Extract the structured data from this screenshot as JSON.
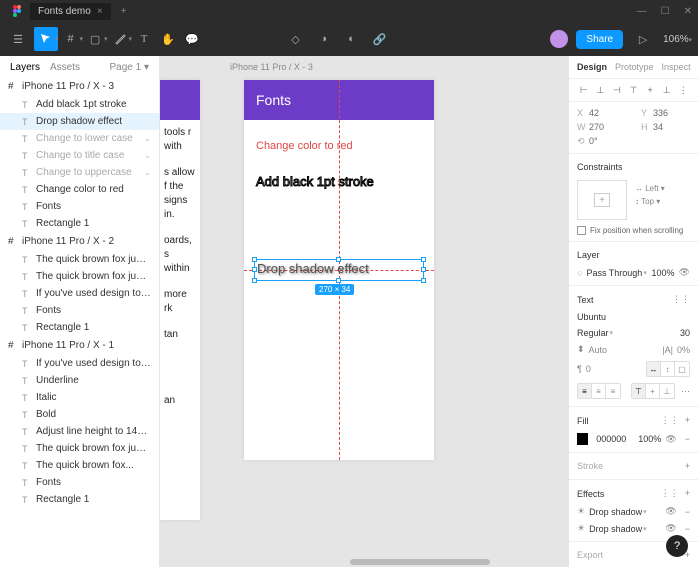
{
  "titlebar": {
    "tab": "Fonts demo"
  },
  "toolbar": {
    "zoom": "106%",
    "share": "Share"
  },
  "leftpanel": {
    "tab_layers": "Layers",
    "tab_assets": "Assets",
    "page": "Page 1",
    "frames": [
      {
        "name": "iPhone 11 Pro / X - 3",
        "items": [
          {
            "label": "Add black 1pt stroke",
            "dim": false
          },
          {
            "label": "Drop shadow effect",
            "dim": false,
            "selected": true
          },
          {
            "label": "Change to lower case",
            "dim": true,
            "chev": true
          },
          {
            "label": "Change to title case",
            "dim": true,
            "chev": true
          },
          {
            "label": "Change to uppercase",
            "dim": true,
            "chev": true
          },
          {
            "label": "Change color to red",
            "dim": false
          },
          {
            "label": "Fonts",
            "dim": false
          },
          {
            "label": "Rectangle 1",
            "dim": false
          }
        ]
      },
      {
        "name": "iPhone 11 Pro / X - 2",
        "items": [
          {
            "label": "The quick brown fox jumped....",
            "dim": false
          },
          {
            "label": "The quick brown fox jumped....",
            "dim": false
          },
          {
            "label": "If you've used design tools be...",
            "dim": false
          },
          {
            "label": "Fonts",
            "dim": false
          },
          {
            "label": "Rectangle 1",
            "dim": false
          }
        ]
      },
      {
        "name": "iPhone 11 Pro / X - 1",
        "items": [
          {
            "label": "If you've used design tools be...",
            "dim": false
          },
          {
            "label": "Underline",
            "dim": false
          },
          {
            "label": "Italic",
            "dim": false
          },
          {
            "label": "Bold",
            "dim": false
          },
          {
            "label": "Adjust line height to 140% an...",
            "dim": false
          },
          {
            "label": "The quick brown fox jumped....",
            "dim": false
          },
          {
            "label": "The quick brown fox...",
            "dim": false
          },
          {
            "label": "Fonts",
            "dim": false
          },
          {
            "label": "Rectangle 1",
            "dim": false
          }
        ]
      }
    ]
  },
  "canvas": {
    "crumb": "iPhone 11 Pro / X - 3",
    "header": "Fonts",
    "red_text": "Change color to red",
    "stroke_text": "Add black 1pt stroke",
    "shadow_text": "Drop shadow effect",
    "dims": "270 × 34",
    "partial_texts": [
      "tools r with",
      "s allow f the signs in.",
      "oards, s within",
      "more rk",
      "tan",
      "an"
    ]
  },
  "rightpanel": {
    "tab_design": "Design",
    "tab_proto": "Prototype",
    "tab_inspect": "Inspect",
    "x": "42",
    "y": "336",
    "w": "270",
    "h": "34",
    "rot": "0°",
    "constraints": "Constraints",
    "con_left": "Left",
    "con_top": "Top",
    "fix": "Fix position when scrolling",
    "layer": "Layer",
    "blend": "Pass Through",
    "opacity": "100%",
    "text": "Text",
    "font": "Ubuntu",
    "weight": "Regular",
    "size": "30",
    "lh_mode": "Auto",
    "ls": "0%",
    "para": "0",
    "fill": "Fill",
    "fill_hex": "000000",
    "fill_op": "100%",
    "stroke": "Stroke",
    "effects": "Effects",
    "eff1": "Drop shadow",
    "eff2": "Drop shadow",
    "export": "Export"
  }
}
